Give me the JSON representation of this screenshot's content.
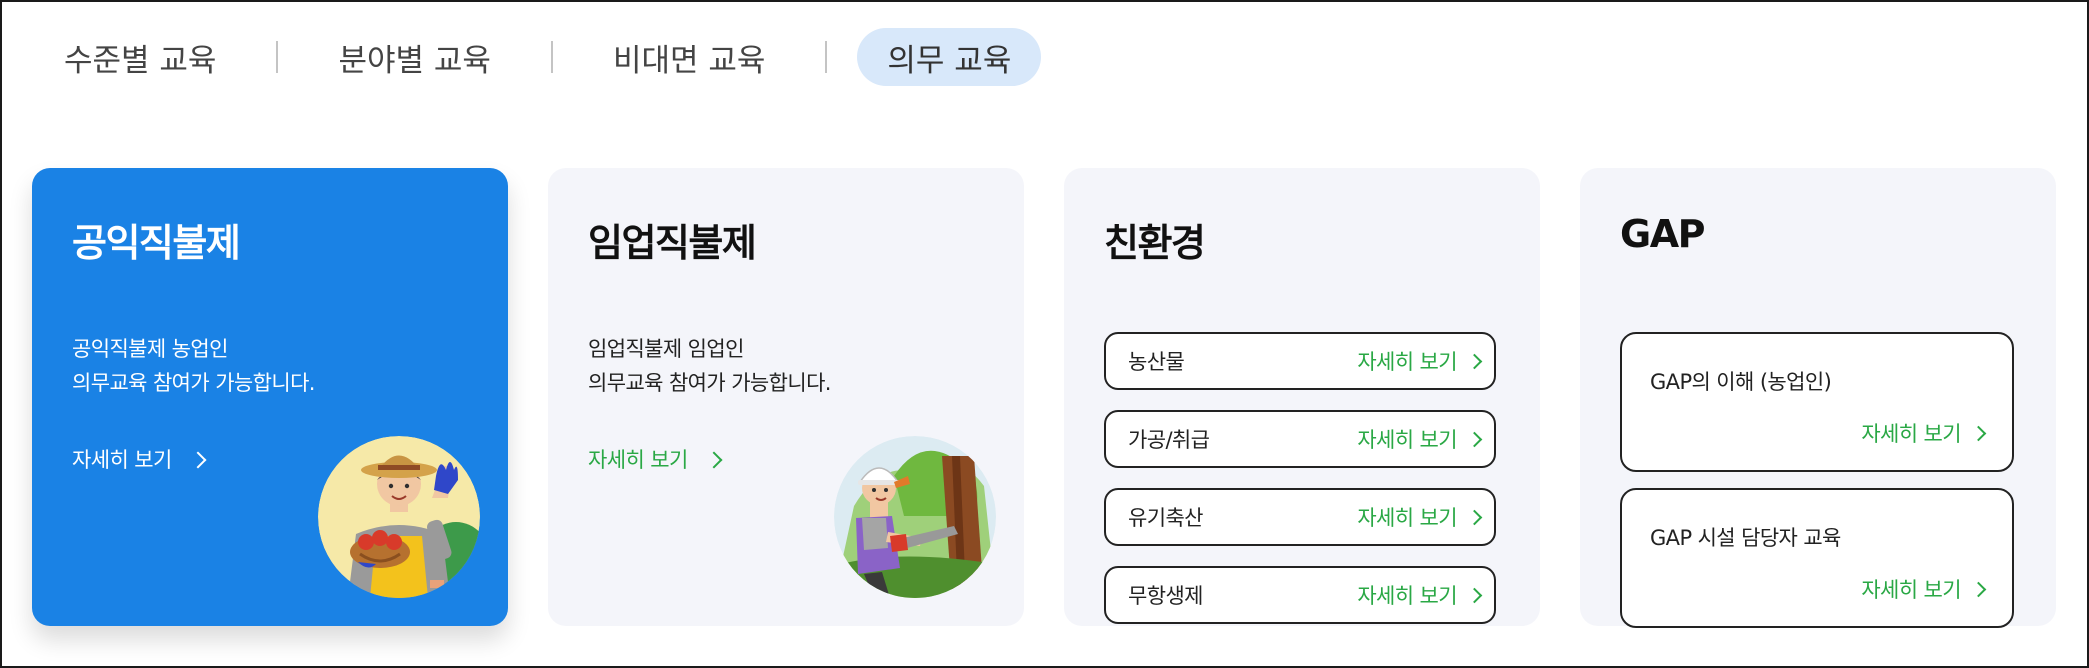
{
  "tabs": [
    {
      "label": "수준별 교육"
    },
    {
      "label": "분야별 교육"
    },
    {
      "label": "비대면 교육"
    },
    {
      "label": "의무 교육",
      "active": true
    }
  ],
  "cards": [
    {
      "title": "공익직불제",
      "desc_line1": "공익직불제 농업인",
      "desc_line2": "의무교육 참여가 가능합니다.",
      "link": "자세히 보기",
      "icon": "farmer-illustration"
    },
    {
      "title": "임업직불제",
      "desc_line1": "임업직불제 임업인",
      "desc_line2": "의무교육 참여가 가능합니다.",
      "link": "자세히 보기",
      "icon": "forester-illustration"
    },
    {
      "title": "친환경",
      "items": [
        {
          "label": "농산물",
          "link": "자세히 보기"
        },
        {
          "label": "가공/취급",
          "link": "자세히 보기"
        },
        {
          "label": "유기축산",
          "link": "자세히 보기"
        },
        {
          "label": "무항생제",
          "link": "자세히 보기"
        }
      ]
    },
    {
      "title": "GAP",
      "items": [
        {
          "label": "GAP의 이해 (농업인)",
          "link": "자세히 보기"
        },
        {
          "label": "GAP 시설 담당자 교육",
          "link": "자세히 보기"
        }
      ]
    }
  ],
  "colors": {
    "primary": "#1a82e5",
    "active_tab_bg": "#d8e8fa",
    "link_green": "#2aa845",
    "card_bg": "#f4f5fa"
  }
}
